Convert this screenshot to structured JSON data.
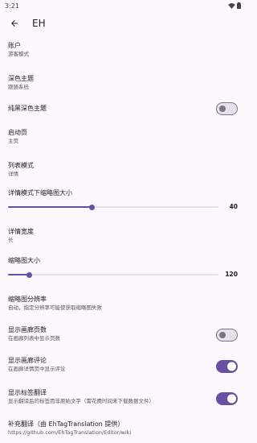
{
  "status_bar": {
    "time": "3:21"
  },
  "app_bar": {
    "title": "EH"
  },
  "settings": {
    "account": {
      "title": "账户",
      "value": "游客模式"
    },
    "dark_theme": {
      "title": "深色主题",
      "value": "跟随系统"
    },
    "pure_black": {
      "title": "纯黑深色主题",
      "checked": false
    },
    "start_page": {
      "title": "启动页",
      "value": "主页"
    },
    "list_mode": {
      "title": "列表模式",
      "value": "详情"
    },
    "detail_thumb_size": {
      "title": "详情模式下缩略图大小",
      "value": "40",
      "min": 0,
      "max": 100
    },
    "detail_width": {
      "title": "详情宽度",
      "value": "长"
    },
    "thumb_size": {
      "title": "缩略图大小",
      "value": "120",
      "min": 100,
      "max": 300
    },
    "thumb_resolution": {
      "title": "缩略图分辨率",
      "value": "自动，指定分辨率可能使获取缩略图失败"
    },
    "show_page_count": {
      "title": "显示画廊页数",
      "value": "在画廊列表中显示页数",
      "checked": false
    },
    "show_comments": {
      "title": "显示画廊评论",
      "value": "在画廊详情页中显示评论",
      "checked": true
    },
    "show_tag_translation": {
      "title": "显示标签翻译",
      "value": "显示翻译后的标签而非原始文字（需花费时间来下载数据文件）",
      "checked": true
    },
    "supplement_translation": {
      "title": "补充翻译（由 EhTagTranslation 提供）",
      "value": "https://github.com/EhTagTranslation/Editor/wiki"
    }
  },
  "colors": {
    "accent": "#6750a4",
    "background": "#fdf8fd"
  }
}
